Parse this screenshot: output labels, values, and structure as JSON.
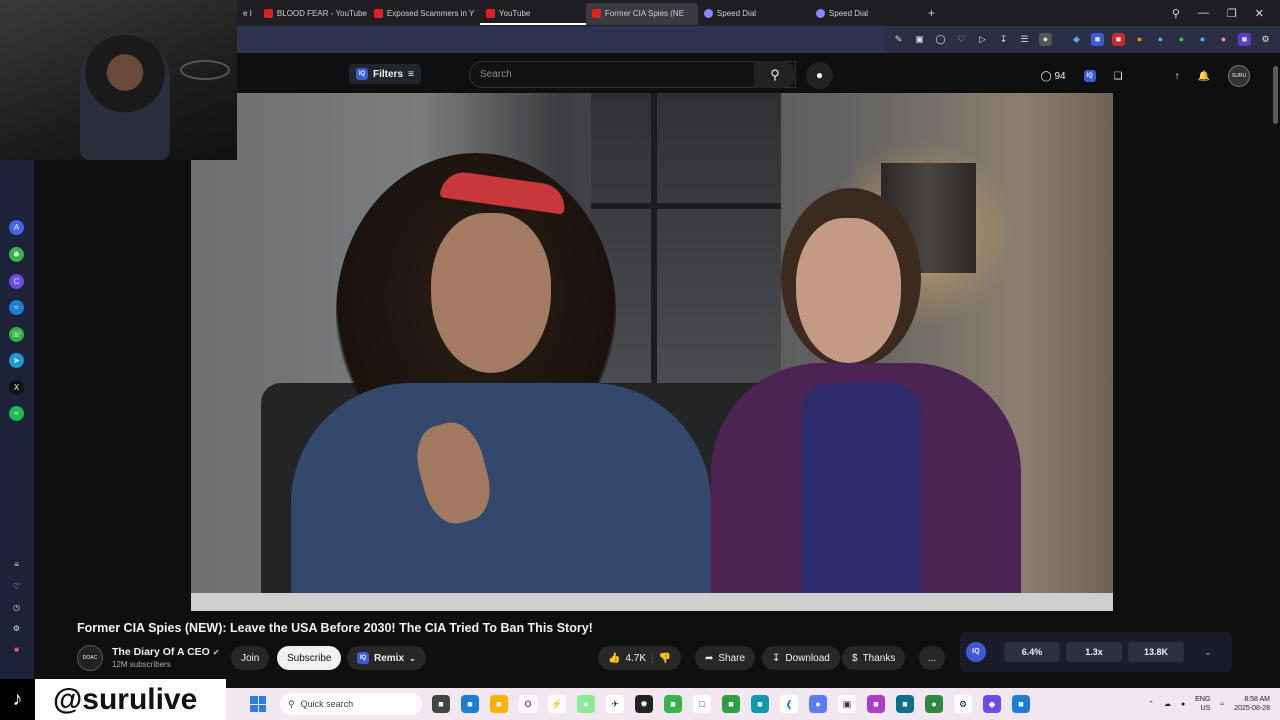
{
  "browser": {
    "tabs": [
      {
        "label": "e I",
        "icon": "none",
        "active": false
      },
      {
        "label": "BLOOD FEAR - YouTube",
        "icon": "youtube",
        "active": false
      },
      {
        "label": "Exposed Scammers in Y",
        "icon": "youtube",
        "active": false
      },
      {
        "label": "YouTube",
        "icon": "youtube",
        "active": false
      },
      {
        "label": "Former CIA Spies (NE",
        "icon": "youtube",
        "active": true
      },
      {
        "label": "Speed Dial",
        "icon": "speed-dial",
        "active": false
      },
      {
        "label": "Speed Dial",
        "icon": "speed-dial",
        "active": false
      }
    ]
  },
  "header": {
    "filters_label": "Filters",
    "search_placeholder": "Search",
    "notification_count": "94",
    "avatar_label": "SURU"
  },
  "video": {
    "title": "Former CIA Spies (NEW): Leave the USA Before 2030! The CIA Tried To Ban This Story!",
    "channel_name": "The Diary Of A CEO",
    "channel_avatar_label": "DOAC",
    "subscribers": "12M subscribers",
    "join_label": "Join",
    "subscribe_label": "Subscribe",
    "remix_label": "Remix",
    "likes": "4.7K",
    "share_label": "Share",
    "download_label": "Download",
    "thanks_label": "Thanks",
    "more_label": "..."
  },
  "stats_extension": {
    "engagement": "6.4%",
    "multiplier": "1.3x",
    "count": "13.8K"
  },
  "overlay": {
    "handle": "@surulive"
  },
  "taskbar": {
    "search_placeholder": "Quick search",
    "lang": "ENG",
    "region": "US",
    "time": "8:58 AM",
    "date": "2025-08-28"
  }
}
